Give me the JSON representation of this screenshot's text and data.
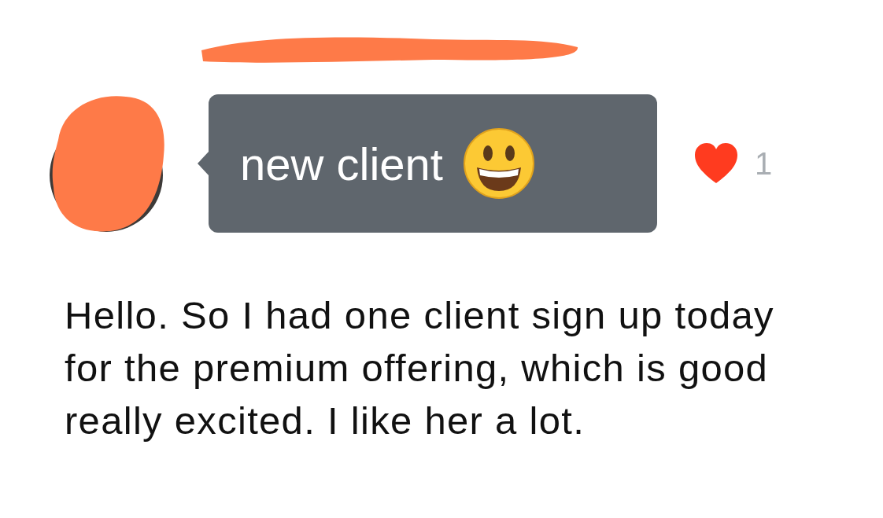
{
  "message": {
    "bubble_text": "new client",
    "liked": true,
    "like_count": "1"
  },
  "body_text": "Hello. So I had one client sign up today for the premium offering, which is good really excited. I like her a lot."
}
